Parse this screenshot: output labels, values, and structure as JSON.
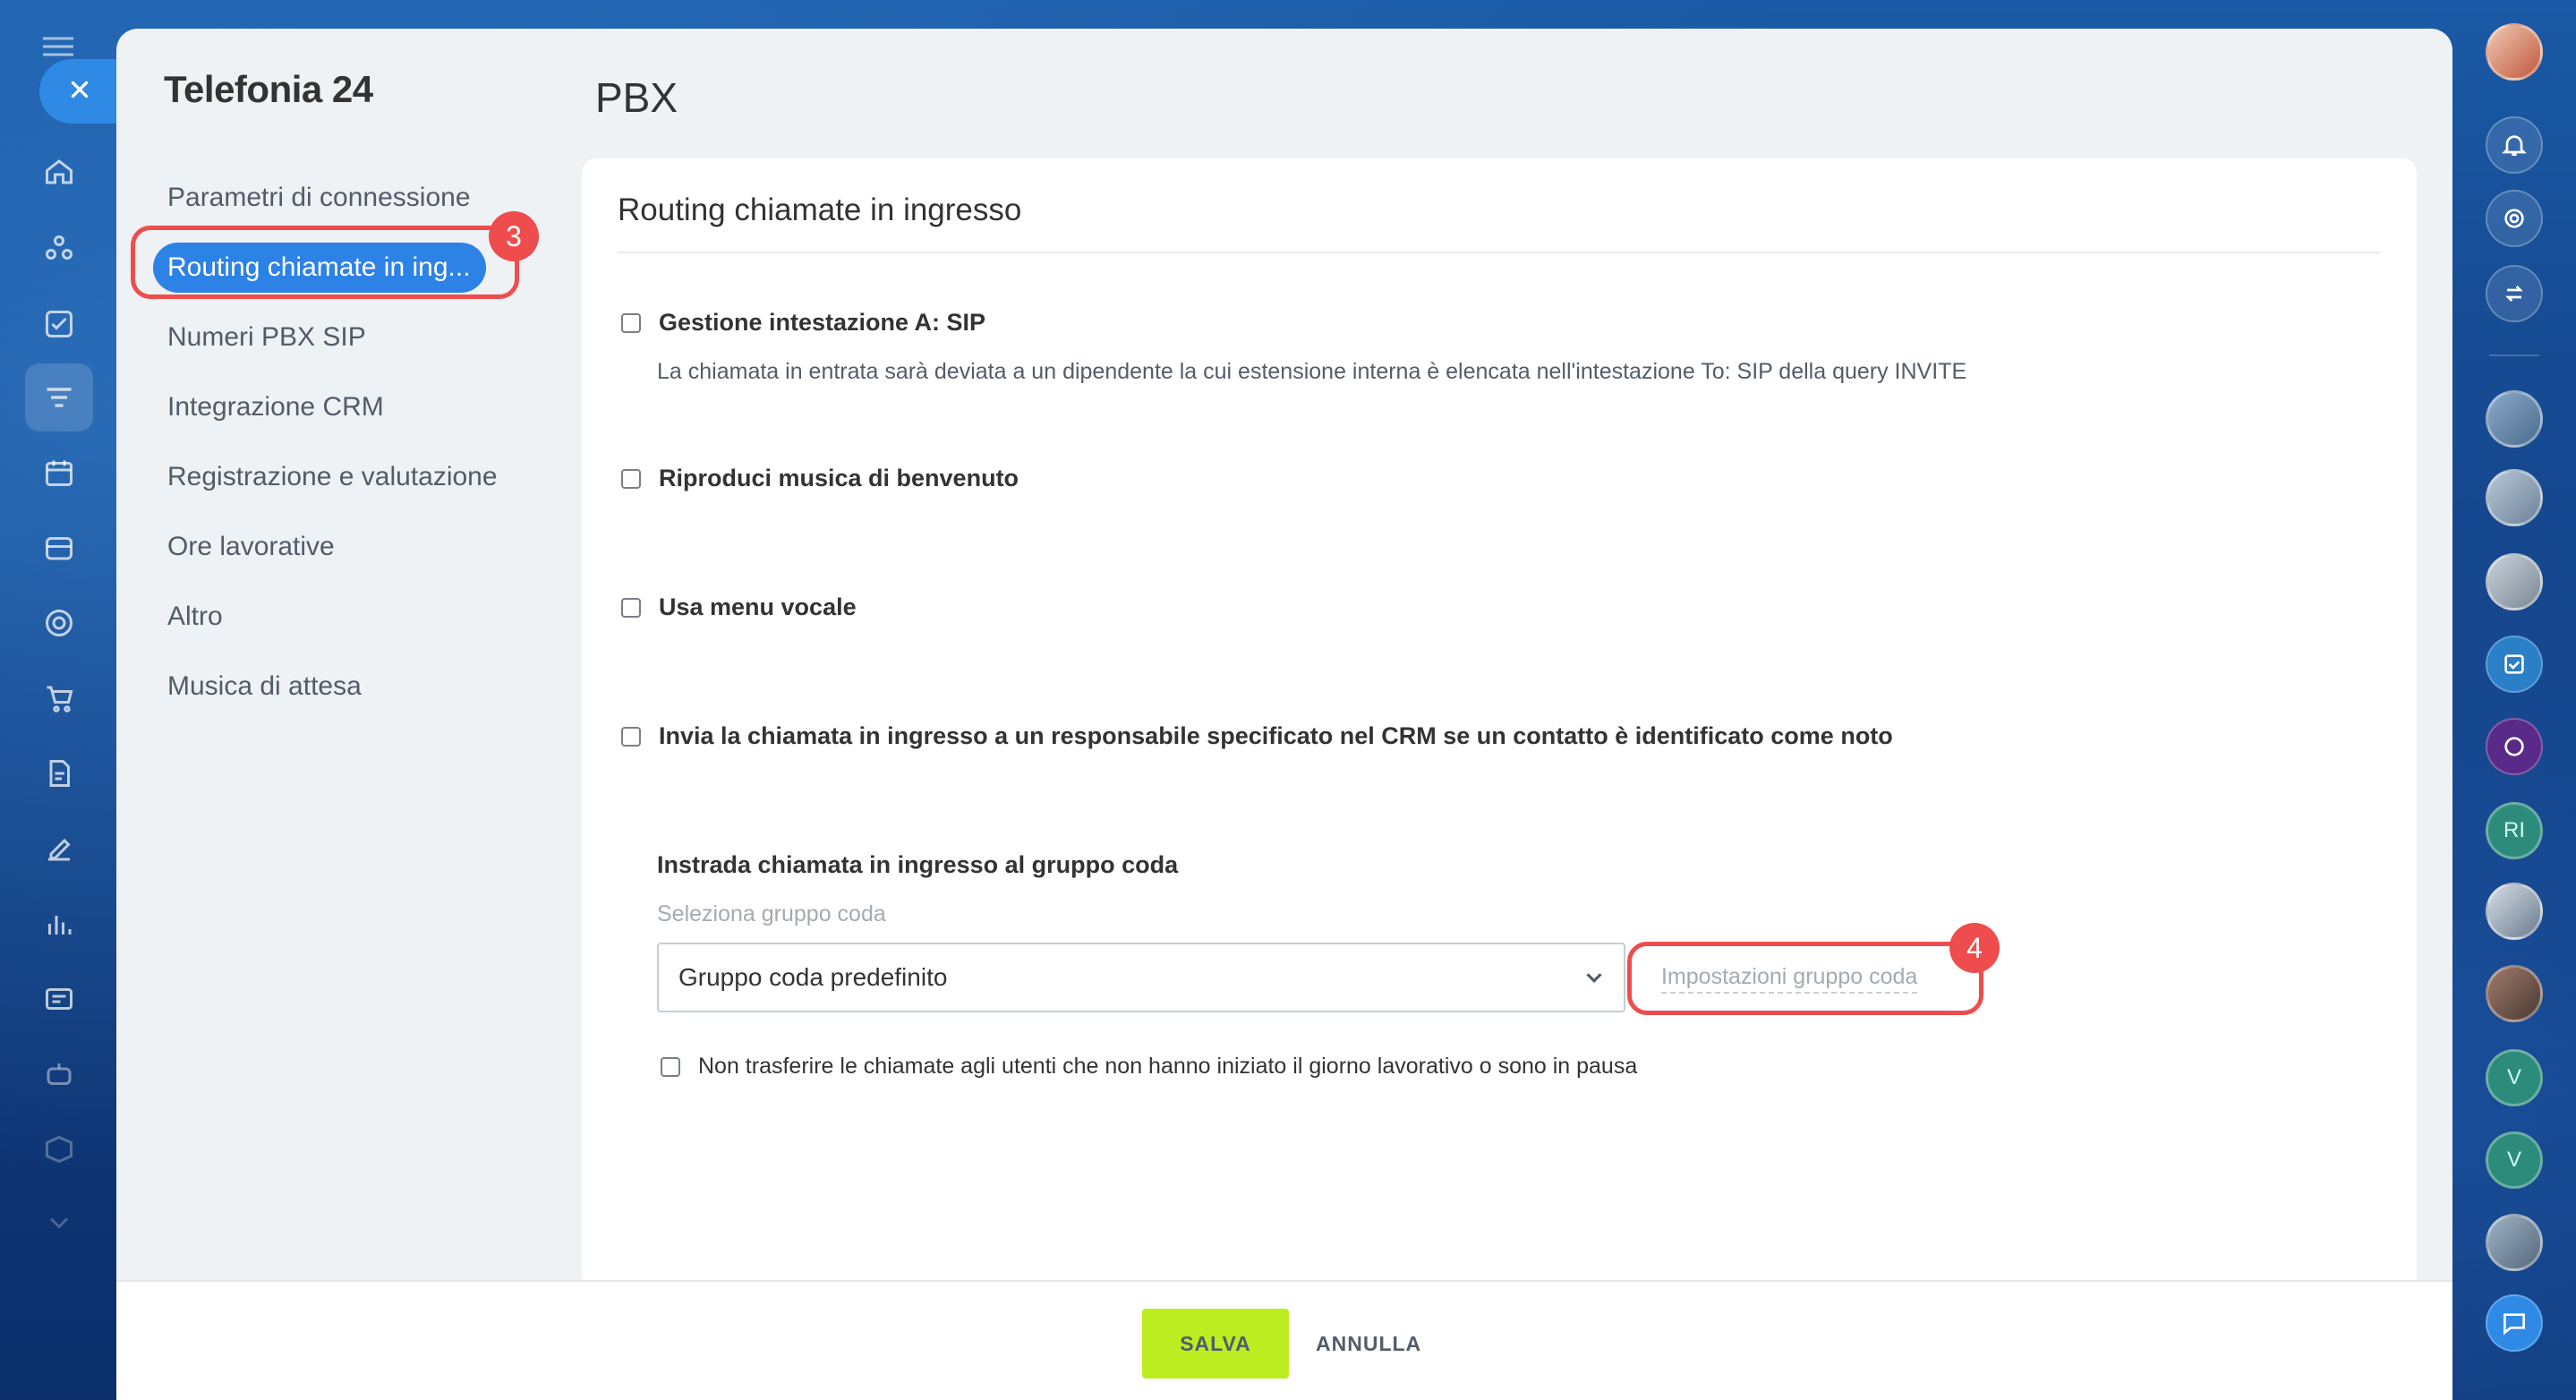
{
  "app": {
    "title": "Telefonia 24"
  },
  "page": {
    "title": "PBX"
  },
  "menu": {
    "items": [
      {
        "label": "Parametri di connessione"
      },
      {
        "label": "Routing chiamate in ing..."
      },
      {
        "label": "Numeri PBX SIP"
      },
      {
        "label": "Integrazione CRM"
      },
      {
        "label": "Registrazione e valutazione"
      },
      {
        "label": "Ore lavorative"
      },
      {
        "label": "Altro"
      },
      {
        "label": "Musica di attesa"
      }
    ],
    "selected_index": 1
  },
  "callouts": {
    "step3": "3",
    "step4": "4"
  },
  "card": {
    "title": "Routing chiamate in ingresso",
    "options": [
      {
        "label": "Gestione intestazione A: SIP",
        "checked": false,
        "description": "La chiamata in entrata sarà deviata a un dipendente la cui estensione interna è elencata nell'intestazione To: SIP della query INVITE"
      },
      {
        "label": "Riproduci musica di benvenuto",
        "checked": false
      },
      {
        "label": "Usa menu vocale",
        "checked": false
      },
      {
        "label": "Invia la chiamata in ingresso a un responsabile specificato nel CRM se un contatto è identificato come noto",
        "checked": false
      }
    ],
    "queue": {
      "title": "Instrada chiamata in ingresso al gruppo coda",
      "select_label": "Seleziona gruppo coda",
      "selected": "Gruppo coda predefinito",
      "settings_link": "Impostazioni gruppo coda",
      "no_transfer_label": "Non trasferire le chiamate agli utenti che non hanno iniziato il giorno lavorativo o sono in pausa",
      "no_transfer_checked": false
    }
  },
  "footer": {
    "save_label": "SALVA",
    "cancel_label": "ANNULLA"
  },
  "rightbar": {
    "letters": [
      "RI",
      "V",
      "V"
    ]
  },
  "colors": {
    "accent": "#2d82e6",
    "save": "#bbed21",
    "callout": "#ef4d4d"
  }
}
